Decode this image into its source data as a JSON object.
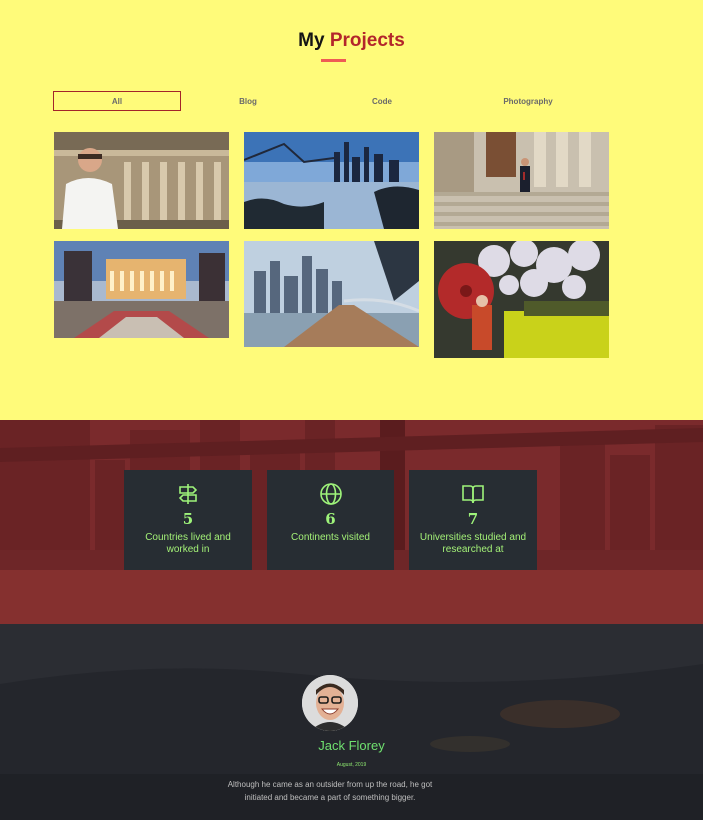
{
  "projects": {
    "title_plain": "My",
    "title_accent": "Projects",
    "filters": [
      "All",
      "Blog",
      "Code",
      "Photography"
    ]
  },
  "stats": [
    {
      "icon": "signpost-icon",
      "value": "5",
      "label": "Countries lived and worked in"
    },
    {
      "icon": "globe-icon",
      "value": "6",
      "label": "Continents visited"
    },
    {
      "icon": "book-icon",
      "value": "7",
      "label": "Universities studied and researched at"
    }
  ],
  "testimonial": {
    "name": "Jack Florey",
    "date": "August, 2019",
    "quote": "Although he came as an outsider from up the road, he got initiated and became a part of something bigger."
  },
  "colors": {
    "page_bg": "#fffb7a",
    "accent": "#b3262b",
    "stats_bg": "#7a2a2c",
    "card_bg": "#272d33",
    "stat_text": "#9ef37a",
    "testimonial_bg": "#24262c"
  }
}
